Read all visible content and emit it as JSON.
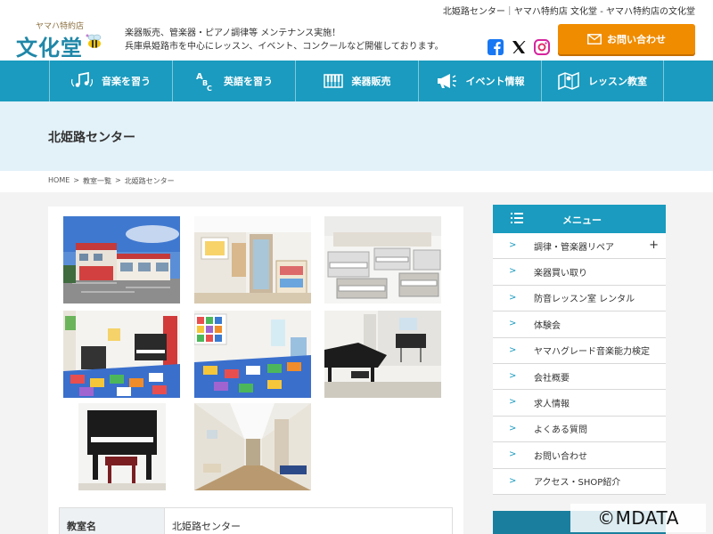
{
  "header": {
    "site_title": "北姫路センター｜ヤマハ特約店 文化堂 - ヤマハ特約店の文化堂",
    "logo_sub": "ヤマハ特約店",
    "logo_main": "文化堂",
    "tagline_1": "楽器販売、管楽器・ピアノ調律等 メンテナンス実施！",
    "tagline_2": "兵庫県姫路市を中心にレッスン、イベント、コンクールなど開催しております。",
    "contact_label": "お問い合わせ",
    "colors": {
      "accent": "#1a9bbf",
      "cta": "#f08c00"
    }
  },
  "nav": {
    "items": [
      {
        "label": "音楽を習う",
        "icon": "music-notes-icon"
      },
      {
        "label": "英語を習う",
        "icon": "abc-icon"
      },
      {
        "label": "楽器販売",
        "icon": "keyboard-icon"
      },
      {
        "label": "イベント情報",
        "icon": "megaphone-icon"
      },
      {
        "label": "レッスン教室",
        "icon": "map-icon"
      }
    ]
  },
  "page": {
    "title": "北姫路センター",
    "breadcrumb": [
      "HOME",
      ">",
      "教室一覧",
      ">",
      "北姫路センター"
    ]
  },
  "info": {
    "label": "教室名",
    "value": "北姫路センター"
  },
  "sidebar": {
    "heading": "メニュー",
    "items": [
      {
        "label": "調律・管楽器リペア",
        "expand": "+"
      },
      {
        "label": "楽器買い取り"
      },
      {
        "label": "防音レッスン室 レンタル"
      },
      {
        "label": "体験会"
      },
      {
        "label": "ヤマハグレード音楽能力検定"
      },
      {
        "label": "会社概要"
      },
      {
        "label": "求人情報"
      },
      {
        "label": "よくある質問"
      },
      {
        "label": "お問い合わせ"
      },
      {
        "label": "アクセス・SHOP紹介"
      }
    ],
    "chevron": ">"
  },
  "watermark": "©MDATA"
}
